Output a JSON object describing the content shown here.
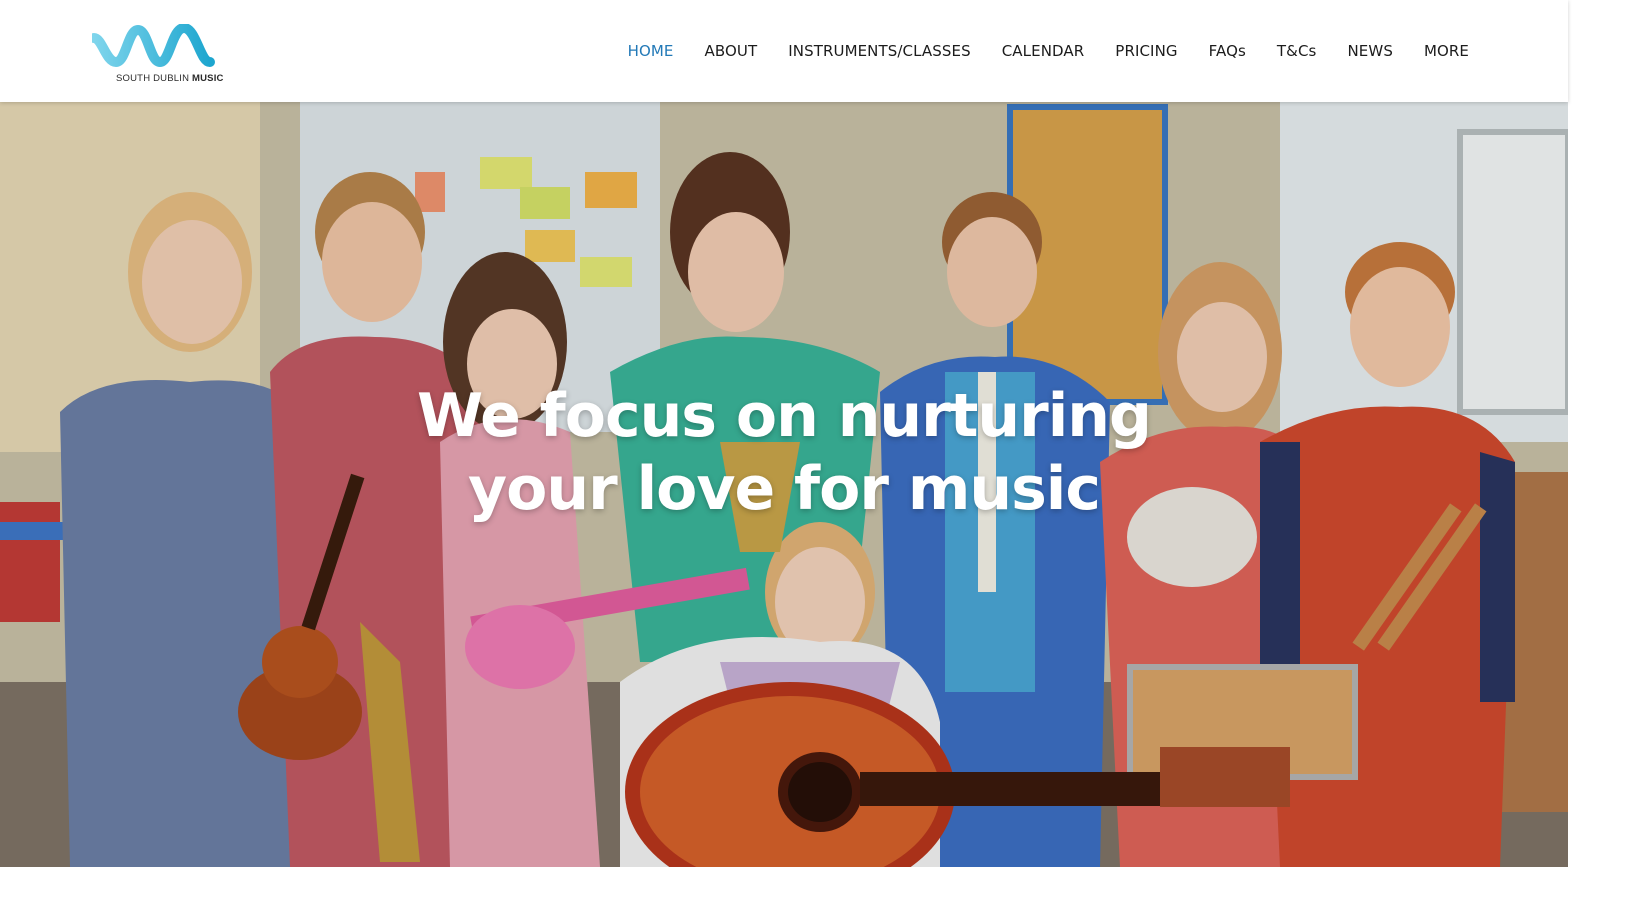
{
  "logo": {
    "text_regular": "SOUTH DUBLIN ",
    "text_bold": "MUSIC",
    "colors": {
      "wave_dark": "#1da6cf",
      "wave_light": "#7fd5ec"
    }
  },
  "nav": {
    "items": [
      {
        "label": "HOME",
        "active": true
      },
      {
        "label": "ABOUT"
      },
      {
        "label": "INSTRUMENTS/CLASSES"
      },
      {
        "label": "CALENDAR"
      },
      {
        "label": "PRICING"
      },
      {
        "label": "FAQs"
      },
      {
        "label": "T&Cs"
      },
      {
        "label": "NEWS"
      },
      {
        "label": "MORE"
      }
    ],
    "active_color": "#2279b7",
    "text_color": "#1c1c1c"
  },
  "hero": {
    "title_line1": "We focus on nurturing",
    "title_line2": "your love for music",
    "image": "photo-children-with-instruments-in-classroom"
  }
}
